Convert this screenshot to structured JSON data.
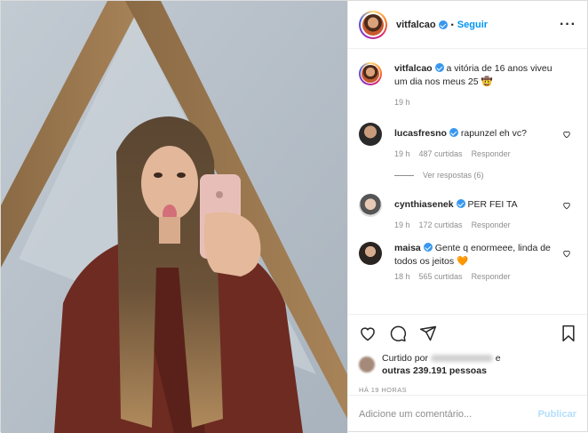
{
  "post": {
    "username": "vitfalcao",
    "follow_label": "Seguir",
    "dot": "•",
    "more_icon": "more-options-icon"
  },
  "caption": {
    "username": "vitfalcao",
    "text": "a vitória de 16 anos viveu um dia nos meus 25 🤠",
    "time": "19 h"
  },
  "comments": [
    {
      "username": "lucasfresno",
      "text": "rapunzel eh vc?",
      "time": "19 h",
      "likes": "487 curtidas",
      "reply": "Responder",
      "view_replies": "Ver respostas (6)"
    },
    {
      "username": "cynthiasenek",
      "text": "PER FEI TA",
      "time": "19 h",
      "likes": "172 curtidas",
      "reply": "Responder"
    },
    {
      "username": "maisa",
      "text": "Gente q enormeee, linda de todos os jeitos 🧡",
      "time": "18 h",
      "likes": "565 curtidas",
      "reply": "Responder"
    }
  ],
  "likes": {
    "prefix": "Curtido por",
    "suffix": "e",
    "others": "outras 239.191 pessoas"
  },
  "timestamp": "HÁ 19 HORAS",
  "add_comment": {
    "placeholder": "Adicione um comentário...",
    "publish_label": "Publicar"
  },
  "colors": {
    "accent": "#0095f6",
    "verified": "#3897f0",
    "muted": "#8e8e8e",
    "publish_disabled": "#b2dffc"
  }
}
